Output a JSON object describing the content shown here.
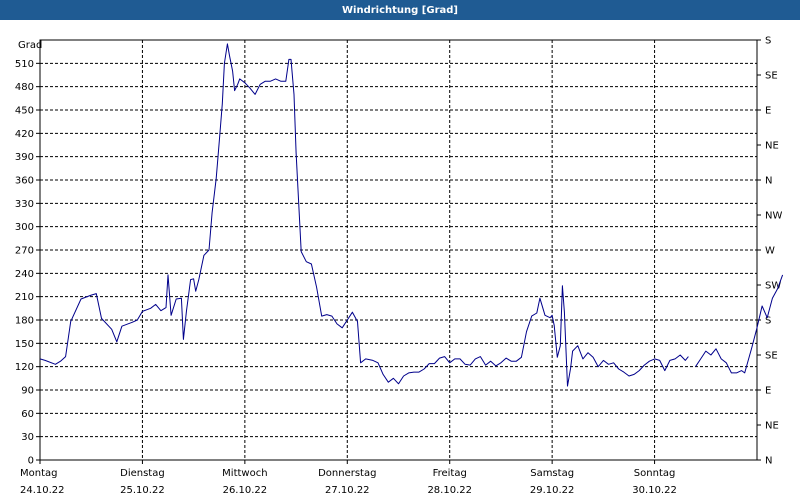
{
  "title": "Windrichtung [Grad]",
  "chart_data": {
    "type": "line",
    "title": "Windrichtung [Grad]",
    "ylabel": "Grad",
    "ylim": [
      0,
      540
    ],
    "yticks": [
      0,
      30,
      60,
      90,
      120,
      150,
      180,
      210,
      240,
      270,
      300,
      330,
      360,
      390,
      420,
      450,
      480,
      510
    ],
    "right_axis_labels": [
      "S",
      "SE",
      "E",
      "NE",
      "N",
      "NW",
      "W",
      "SW",
      "S",
      "SE",
      "E",
      "NE",
      "N"
    ],
    "xlim": [
      0,
      7
    ],
    "x_ticks": [
      {
        "day": "Montag",
        "date": "24.10.22"
      },
      {
        "day": "Dienstag",
        "date": "25.10.22"
      },
      {
        "day": "Mittwoch",
        "date": "26.10.22"
      },
      {
        "day": "Donnerstag",
        "date": "27.10.22"
      },
      {
        "day": "Freitag",
        "date": "28.10.22"
      },
      {
        "day": "Samstag",
        "date": "29.10.22"
      },
      {
        "day": "Sonntag",
        "date": "30.10.22"
      }
    ],
    "grid": true,
    "series": [
      {
        "color": "#00008b",
        "segments": [
          [
            [
              0.0,
              130
            ],
            [
              0.05,
              128
            ],
            [
              0.15,
              123
            ],
            [
              0.2,
              127
            ],
            [
              0.25,
              133
            ],
            [
              0.3,
              178
            ],
            [
              0.4,
              207
            ],
            [
              0.5,
              212
            ],
            [
              0.55,
              214
            ],
            [
              0.6,
              182
            ],
            [
              0.7,
              168
            ],
            [
              0.75,
              152
            ],
            [
              0.8,
              172
            ],
            [
              0.9,
              177
            ],
            [
              0.95,
              180
            ],
            [
              1.0,
              191
            ],
            [
              1.08,
              195
            ],
            [
              1.13,
              200
            ],
            [
              1.18,
              192
            ],
            [
              1.23,
              196
            ],
            [
              1.25,
              238
            ],
            [
              1.28,
              186
            ],
            [
              1.33,
              207
            ],
            [
              1.38,
              208
            ],
            [
              1.4,
              155
            ],
            [
              1.43,
              192
            ],
            [
              1.47,
              232
            ],
            [
              1.5,
              233
            ],
            [
              1.52,
              217
            ],
            [
              1.55,
              232
            ],
            [
              1.6,
              263
            ],
            [
              1.65,
              270
            ],
            [
              1.68,
              318
            ],
            [
              1.72,
              362
            ],
            [
              1.75,
              410
            ],
            [
              1.78,
              458
            ],
            [
              1.8,
              510
            ],
            [
              1.83,
              535
            ],
            [
              1.85,
              520
            ],
            [
              1.88,
              500
            ],
            [
              1.9,
              475
            ],
            [
              1.93,
              483
            ],
            [
              1.95,
              490
            ],
            [
              2.0,
              485
            ],
            [
              2.05,
              478
            ],
            [
              2.1,
              470
            ],
            [
              2.15,
              483
            ],
            [
              2.2,
              487
            ],
            [
              2.25,
              487
            ],
            [
              2.3,
              490
            ],
            [
              2.35,
              487
            ],
            [
              2.4,
              487
            ],
            [
              2.43,
              515
            ],
            [
              2.45,
              515
            ],
            [
              2.48,
              470
            ],
            [
              2.5,
              395
            ],
            [
              2.55,
              268
            ],
            [
              2.6,
              255
            ],
            [
              2.65,
              252
            ],
            [
              2.7,
              222
            ],
            [
              2.75,
              185
            ],
            [
              2.8,
              187
            ],
            [
              2.85,
              185
            ],
            [
              2.9,
              175
            ],
            [
              2.95,
              170
            ],
            [
              3.0,
              180
            ],
            [
              3.05,
              190
            ],
            [
              3.1,
              178
            ],
            [
              3.13,
              125
            ],
            [
              3.18,
              130
            ],
            [
              3.25,
              128
            ],
            [
              3.3,
              125
            ],
            [
              3.35,
              110
            ],
            [
              3.4,
              100
            ],
            [
              3.45,
              105
            ],
            [
              3.5,
              98
            ],
            [
              3.55,
              108
            ],
            [
              3.6,
              112
            ],
            [
              3.65,
              113
            ],
            [
              3.7,
              113
            ],
            [
              3.75,
              117
            ],
            [
              3.8,
              124
            ],
            [
              3.85,
              124
            ],
            [
              3.9,
              131
            ],
            [
              3.95,
              133
            ],
            [
              4.0,
              125
            ],
            [
              4.05,
              130
            ],
            [
              4.1,
              130
            ],
            [
              4.15,
              123
            ],
            [
              4.2,
              122
            ],
            [
              4.25,
              130
            ],
            [
              4.3,
              133
            ],
            [
              4.35,
              122
            ],
            [
              4.4,
              127
            ],
            [
              4.45,
              121
            ],
            [
              4.5,
              125
            ],
            [
              4.55,
              131
            ],
            [
              4.6,
              127
            ],
            [
              4.65,
              127
            ],
            [
              4.7,
              132
            ],
            [
              4.75,
              165
            ],
            [
              4.8,
              185
            ],
            [
              4.85,
              189
            ],
            [
              4.88,
              208
            ],
            [
              4.93,
              186
            ],
            [
              4.98,
              183
            ],
            [
              5.0,
              186
            ],
            [
              5.02,
              173
            ],
            [
              5.05,
              132
            ],
            [
              5.08,
              147
            ],
            [
              5.1,
              224
            ],
            [
              5.12,
              190
            ],
            [
              5.15,
              95
            ],
            [
              5.18,
              118
            ],
            [
              5.2,
              140
            ],
            [
              5.25,
              147
            ],
            [
              5.3,
              130
            ],
            [
              5.35,
              138
            ],
            [
              5.4,
              132
            ],
            [
              5.45,
              120
            ],
            [
              5.5,
              128
            ],
            [
              5.55,
              123
            ],
            [
              5.6,
              125
            ],
            [
              5.65,
              117
            ],
            [
              5.7,
              113
            ],
            [
              5.75,
              108
            ],
            [
              5.8,
              110
            ],
            [
              5.85,
              115
            ],
            [
              5.9,
              122
            ],
            [
              5.95,
              127
            ],
            [
              6.0,
              130
            ],
            [
              6.05,
              128
            ],
            [
              6.1,
              115
            ],
            [
              6.15,
              128
            ],
            [
              6.2,
              130
            ],
            [
              6.25,
              135
            ],
            [
              6.3,
              128
            ],
            [
              6.33,
              133
            ]
          ],
          [
            [
              6.4,
              120
            ],
            [
              6.45,
              130
            ],
            [
              6.5,
              140
            ],
            [
              6.55,
              135
            ],
            [
              6.6,
              143
            ],
            [
              6.65,
              130
            ],
            [
              6.7,
              125
            ],
            [
              6.75,
              112
            ],
            [
              6.8,
              112
            ],
            [
              6.85,
              115
            ],
            [
              6.88,
              112
            ],
            [
              6.95,
              145
            ],
            [
              7.0,
              170
            ],
            [
              7.05,
              198
            ],
            [
              7.1,
              183
            ],
            [
              7.15,
              208
            ],
            [
              7.2,
              220
            ],
            [
              7.25,
              238
            ]
          ]
        ]
      }
    ]
  }
}
